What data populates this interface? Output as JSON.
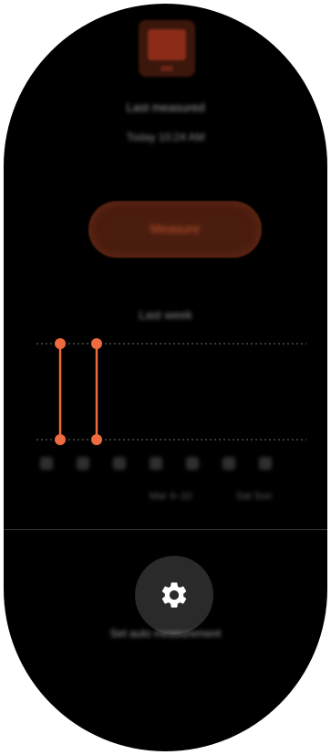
{
  "header": {
    "app_icon": "heart-rate-app-icon",
    "title": "Last measured",
    "subtitle": "Today 10:24 AM"
  },
  "measure_button": {
    "label": "Measure",
    "color": "#4a1d0f",
    "text_color": "#c1562c"
  },
  "history": {
    "title": "Last week",
    "accent_color": "#f06a40",
    "chart_data": {
      "type": "scatter",
      "x": [
        1,
        2,
        3,
        4,
        5,
        6,
        7
      ],
      "series": [
        {
          "values": [
            1,
            1,
            null,
            null,
            null,
            null,
            null
          ]
        },
        {
          "values": [
            0,
            0,
            null,
            null,
            null,
            null,
            null
          ]
        }
      ],
      "grid": true
    },
    "day_labels": [
      "M",
      "T",
      "W",
      "T",
      "F",
      "S",
      "S"
    ],
    "range_label_left": "Mar 4–10",
    "range_label_right": "Sat Sun"
  },
  "settings": {
    "icon": "gear-icon",
    "label": "Set auto measurement"
  }
}
